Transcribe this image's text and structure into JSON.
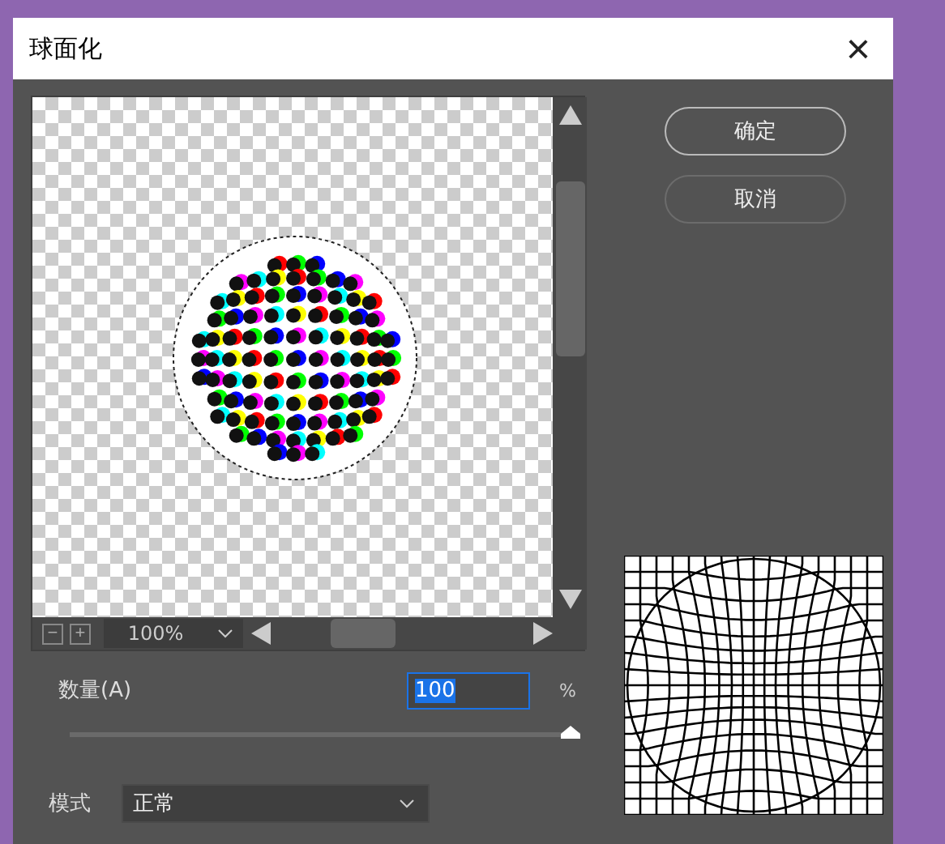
{
  "window": {
    "title": "球面化",
    "close": "×"
  },
  "preview": {
    "zoom": "100%",
    "zoom_out": "−",
    "zoom_in": "+"
  },
  "buttons": [
    {
      "label": "确定",
      "kind": "primary"
    },
    {
      "label": "取消",
      "kind": "secondary"
    }
  ],
  "amount": {
    "label": "数量(A)",
    "value": "100",
    "unit": "%",
    "level": 1
  },
  "mode": {
    "label": "模式",
    "value": "正常"
  }
}
